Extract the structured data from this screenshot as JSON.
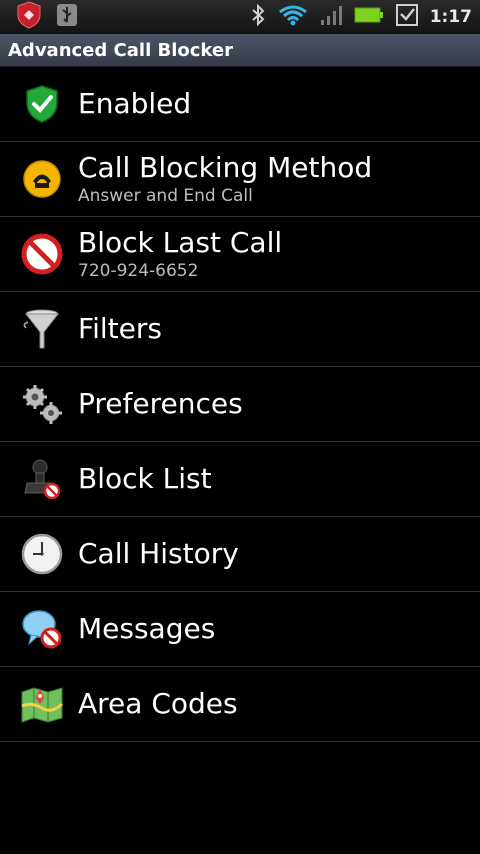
{
  "status": {
    "time": "1:17"
  },
  "app": {
    "title": "Advanced Call Blocker"
  },
  "menu": {
    "items": [
      {
        "label": "Enabled",
        "sub": "",
        "icon": "shield-check-icon"
      },
      {
        "label": "Call Blocking Method",
        "sub": "Answer and End Call",
        "icon": "phone-icon"
      },
      {
        "label": "Block Last Call",
        "sub": "720-924-6652",
        "icon": "no-entry-icon"
      },
      {
        "label": "Filters",
        "sub": "",
        "icon": "funnel-icon"
      },
      {
        "label": "Preferences",
        "sub": "",
        "icon": "gears-icon"
      },
      {
        "label": "Block List",
        "sub": "",
        "icon": "stamp-icon"
      },
      {
        "label": "Call History",
        "sub": "",
        "icon": "clock-icon"
      },
      {
        "label": "Messages",
        "sub": "",
        "icon": "message-block-icon"
      },
      {
        "label": "Area Codes",
        "sub": "",
        "icon": "map-icon"
      }
    ]
  }
}
